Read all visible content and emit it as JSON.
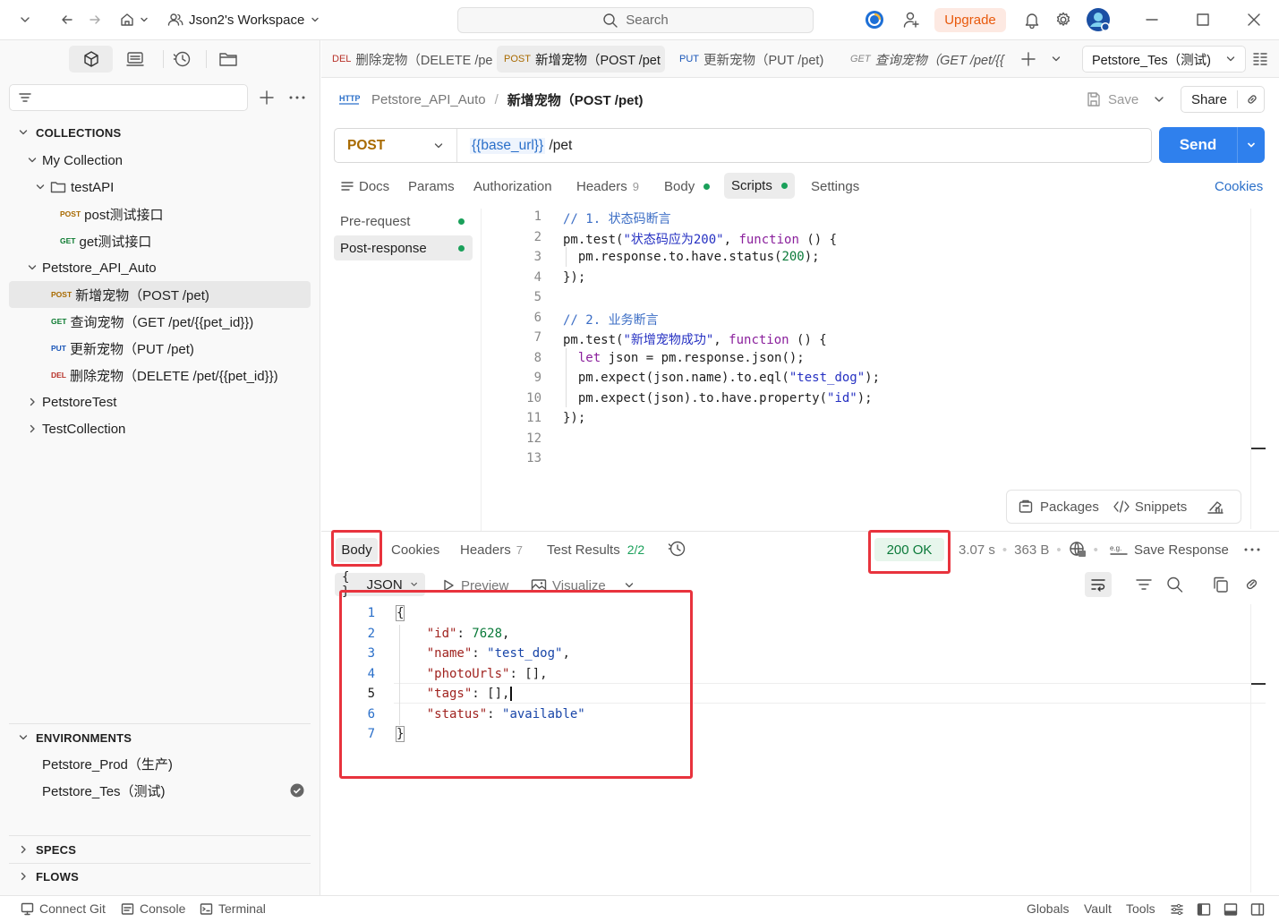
{
  "topbar": {
    "workspace": "Json2's Workspace",
    "search_placeholder": "Search",
    "upgrade": "Upgrade"
  },
  "sidebar": {
    "filter_placeholder": "",
    "collections_header": "COLLECTIONS",
    "tree": [
      {
        "label": "My Collection"
      },
      {
        "label": "testAPI"
      },
      {
        "method": "POST",
        "label": "post测试接口"
      },
      {
        "method": "GET",
        "label": "get测试接口"
      },
      {
        "label": "Petstore_API_Auto"
      },
      {
        "method": "POST",
        "label": "新增宠物（POST /pet)"
      },
      {
        "method": "GET",
        "label": "查询宠物（GET /pet/{{pet_id}})"
      },
      {
        "method": "PUT",
        "label": "更新宠物（PUT /pet)"
      },
      {
        "method": "DEL",
        "label": "删除宠物（DELETE /pet/{{pet_id}})"
      },
      {
        "label": "PetstoreTest"
      },
      {
        "label": "TestCollection"
      }
    ],
    "environments_header": "ENVIRONMENTS",
    "environments": [
      "Petstore_Prod（生产)",
      "Petstore_Tes（测试)"
    ],
    "specs_header": "SPECS",
    "flows_header": "FLOWS"
  },
  "tabs": [
    {
      "method": "DEL",
      "label": "删除宠物（DELETE /pe"
    },
    {
      "method": "POST",
      "label": "新增宠物（POST /pet"
    },
    {
      "method": "PUT",
      "label": "更新宠物（PUT /pet)"
    },
    {
      "method": "GET",
      "label": "查询宠物（GET /pet/{{"
    }
  ],
  "env_selector": "Petstore_Tes（测试)",
  "request": {
    "breadcrumb_collection": "Petstore_API_Auto",
    "breadcrumb_sep": "/",
    "title": "新增宠物（POST /pet)",
    "save": "Save",
    "share": "Share",
    "method": "POST",
    "url_var": "{{base_url}}",
    "url_path": " /pet",
    "send": "Send",
    "tabs": {
      "docs": "Docs",
      "params": "Params",
      "authorization": "Authorization",
      "headers": "Headers",
      "headers_count": "9",
      "body": "Body",
      "scripts": "Scripts",
      "settings": "Settings",
      "cookies": "Cookies"
    },
    "script_tabs": [
      "Pre-request",
      "Post-response"
    ],
    "line_numbers": [
      "1",
      "2",
      "3",
      "4",
      "5",
      "6",
      "7",
      "8",
      "9",
      "10",
      "11",
      "12",
      "13"
    ],
    "packages": "Packages",
    "snippets": "Snippets"
  },
  "response": {
    "tabs": {
      "body": "Body",
      "cookies": "Cookies",
      "headers": "Headers",
      "headers_count": "7",
      "test_results": "Test Results",
      "test_count": "2/2"
    },
    "status": "200 OK",
    "time": "3.07 s",
    "size": "363 B",
    "save_response": "Save Response",
    "format": "JSON",
    "preview": "Preview",
    "visualize": "Visualize",
    "line_numbers": [
      "1",
      "2",
      "3",
      "4",
      "5",
      "6",
      "7"
    ],
    "json": {
      "id": "7628",
      "name": "\"test_dog\"",
      "status": "\"available\""
    }
  },
  "footer": {
    "connect_git": "Connect Git",
    "console": "Console",
    "terminal": "Terminal",
    "globals": "Globals",
    "vault": "Vault",
    "tools": "Tools"
  }
}
